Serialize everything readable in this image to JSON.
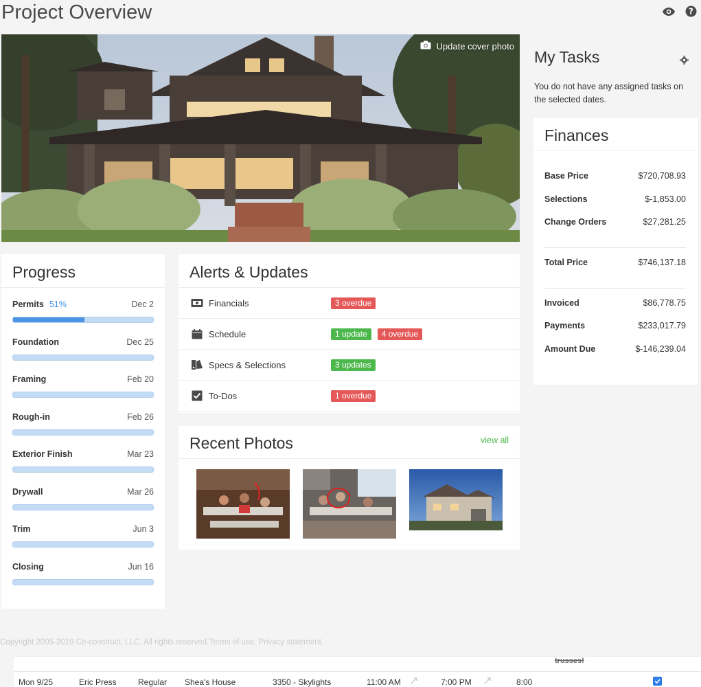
{
  "header": {
    "title": "Project Overview",
    "icons": [
      "eye-icon",
      "help-icon"
    ]
  },
  "cover": {
    "update_label": "Update cover photo"
  },
  "progress": {
    "title": "Progress",
    "phases": [
      {
        "name": "Permits",
        "percent": "51%",
        "date": "Dec 2",
        "fill": 0.51
      },
      {
        "name": "Foundation",
        "percent": "",
        "date": "Dec 25",
        "fill": 0
      },
      {
        "name": "Framing",
        "percent": "",
        "date": "Feb 20",
        "fill": 0
      },
      {
        "name": "Rough-in",
        "percent": "",
        "date": "Feb 26",
        "fill": 0
      },
      {
        "name": "Exterior Finish",
        "percent": "",
        "date": "Mar 23",
        "fill": 0
      },
      {
        "name": "Drywall",
        "percent": "",
        "date": "Mar 26",
        "fill": 0
      },
      {
        "name": "Trim",
        "percent": "",
        "date": "Jun 3",
        "fill": 0
      },
      {
        "name": "Closing",
        "percent": "",
        "date": "Jun 16",
        "fill": 0
      }
    ]
  },
  "alerts": {
    "title": "Alerts & Updates",
    "rows": [
      {
        "label": "Financials",
        "icon": "financials-icon",
        "badges": [
          {
            "text": "3 overdue",
            "color": "#e45858"
          }
        ]
      },
      {
        "label": "Schedule",
        "icon": "calendar-icon",
        "badges": [
          {
            "text": "1 update",
            "color": "#4cb84c"
          },
          {
            "text": "4 overdue",
            "color": "#e45858"
          }
        ]
      },
      {
        "label": "Specs & Selections",
        "icon": "swatch-icon",
        "badges": [
          {
            "text": "3 updates",
            "color": "#4cb84c"
          }
        ]
      },
      {
        "label": "To-Dos",
        "icon": "checkbox-icon",
        "badges": [
          {
            "text": "1 overdue",
            "color": "#e45858"
          }
        ]
      }
    ]
  },
  "photos": {
    "title": "Recent Photos",
    "view_all": "view all"
  },
  "tasks": {
    "title": "My Tasks",
    "message": "You do not have any assigned tasks on the selected dates."
  },
  "finances": {
    "title": "Finances",
    "group1": [
      {
        "label": "Base Price",
        "value": "$720,708.93"
      },
      {
        "label": "Selections",
        "value": "$-1,853.00"
      },
      {
        "label": "Change Orders",
        "value": "$27,281.25"
      }
    ],
    "total": {
      "label": "Total Price",
      "value": "$746,137.18"
    },
    "group2": [
      {
        "label": "Invoiced",
        "value": "$86,778.75"
      },
      {
        "label": "Payments",
        "value": "$233,017.79"
      },
      {
        "label": "Amount Due",
        "value": "$-146,239.04"
      }
    ]
  },
  "footer": {
    "text": "Copyright 2005-2019 Co-construct, LLC. All rights reserved.Terms of use. Privacy statement."
  },
  "table": {
    "prev_row_note": "trusses!",
    "row": {
      "date": "Mon 9/25",
      "person": "Eric Press",
      "type": "Regular",
      "project": "Shea's House",
      "code": "3350 - Skylights",
      "start": "11:00 AM",
      "end": "7:00 PM",
      "hours": "8:00"
    }
  },
  "colors": {
    "accent_blue": "#3a8ee6",
    "overdue_red": "#e45858",
    "update_green": "#4cb84c"
  }
}
